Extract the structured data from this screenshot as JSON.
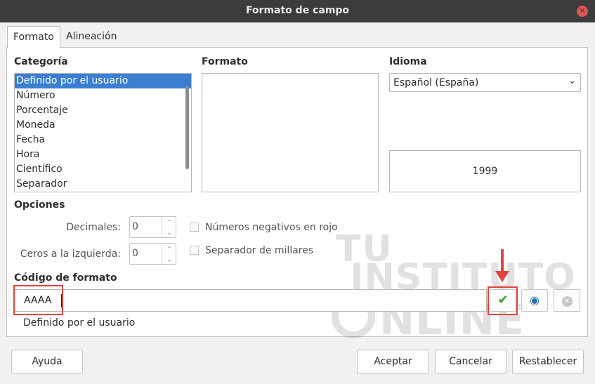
{
  "window": {
    "title": "Formato de campo"
  },
  "tabs": [
    {
      "label": "Formato"
    },
    {
      "label": "Alineación"
    }
  ],
  "category": {
    "label": "Categoría",
    "items": [
      "Definido por el usuario",
      "Número",
      "Porcentaje",
      "Moneda",
      "Fecha",
      "Hora",
      "Científico",
      "Separador"
    ],
    "selected": "Definido por el usuario"
  },
  "format": {
    "label": "Formato"
  },
  "language": {
    "label": "Idioma",
    "value": "Español (España)"
  },
  "preview": {
    "value": "1999"
  },
  "options": {
    "label": "Opciones",
    "decimals_label": "Decimales:",
    "decimals_value": "0",
    "leading_zeros_label": "Ceros a la izquierda:",
    "leading_zeros_value": "0",
    "negative_red_label": "Números negativos en rojo",
    "thousands_sep_label": "Separador de millares"
  },
  "format_code": {
    "label": "Código de formato",
    "value": "AAAA",
    "description": "Definido por el usuario"
  },
  "watermark": {
    "line1": "TU",
    "line2": "INSTITUTO",
    "line3": "NLINE"
  },
  "buttons": {
    "help": "Ayuda",
    "ok": "Aceptar",
    "cancel": "Cancelar",
    "reset": "Restablecer"
  },
  "colors": {
    "selection": "#3a7fd1",
    "highlight": "#e0453c",
    "check": "#3aa12a"
  }
}
